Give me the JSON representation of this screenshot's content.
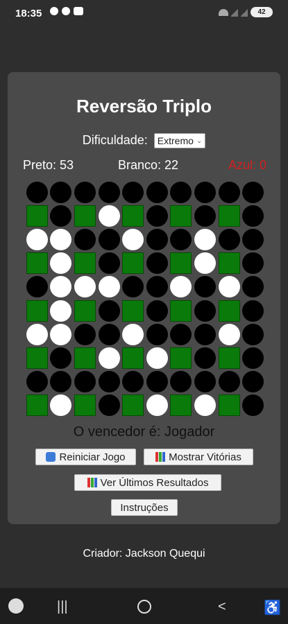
{
  "status_bar": {
    "time": "18:35",
    "battery": "42",
    "left_icons": [
      "whatsapp-icon",
      "link-icon",
      "youtube-icon"
    ],
    "right_icons": [
      "wifi-icon",
      "signal-icon",
      "signal-icon"
    ]
  },
  "game": {
    "title": "Reversão Triplo",
    "difficulty_label": "Dificuldade:",
    "difficulty_value": "Extremo",
    "scores": {
      "preto": "Preto: 53",
      "branco": "Branco: 22",
      "azul": "Azul: 0"
    },
    "colors": {
      "black": "#000000",
      "white": "#ffffff",
      "green": "#0a7a0a",
      "azul_text": "#d32020"
    },
    "board": [
      [
        "B",
        "B",
        "B",
        "B",
        "B",
        "B",
        "B",
        "B",
        "B",
        "B"
      ],
      [
        "G",
        "B",
        "G",
        "W",
        "G",
        "B",
        "G",
        "B",
        "G",
        "B"
      ],
      [
        "W",
        "W",
        "B",
        "B",
        "W",
        "B",
        "B",
        "W",
        "B",
        "B"
      ],
      [
        "G",
        "W",
        "G",
        "B",
        "G",
        "B",
        "G",
        "W",
        "G",
        "B"
      ],
      [
        "B",
        "W",
        "W",
        "W",
        "B",
        "B",
        "W",
        "B",
        "W",
        "B"
      ],
      [
        "G",
        "W",
        "G",
        "B",
        "G",
        "B",
        "G",
        "B",
        "G",
        "B"
      ],
      [
        "W",
        "W",
        "B",
        "B",
        "W",
        "B",
        "B",
        "B",
        "W",
        "B"
      ],
      [
        "G",
        "B",
        "G",
        "W",
        "G",
        "W",
        "G",
        "B",
        "G",
        "B"
      ],
      [
        "B",
        "B",
        "B",
        "B",
        "B",
        "B",
        "B",
        "B",
        "B",
        "B"
      ],
      [
        "G",
        "W",
        "G",
        "B",
        "G",
        "W",
        "G",
        "W",
        "G",
        "B"
      ]
    ],
    "winner_text": "O vencedor é: Jogador",
    "buttons": {
      "restart": "Reiniciar Jogo",
      "show_wins": "Mostrar Vitórias",
      "last_results": "Ver Últimos Resultados",
      "instructions": "Instruções"
    }
  },
  "creator": "Criador: Jackson Quequi",
  "nav": {
    "recent": "|||",
    "back": "<"
  }
}
